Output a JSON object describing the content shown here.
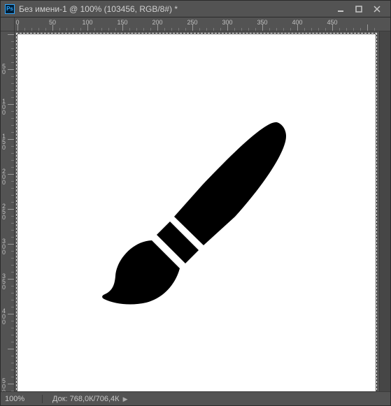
{
  "titlebar": {
    "app_icon": "Ps",
    "title": "Без имени-1 @ 100% (103456, RGB/8#) *"
  },
  "ruler": {
    "h_labels": [
      "0",
      "50",
      "100",
      "150",
      "200",
      "250",
      "300",
      "350",
      "400",
      "450"
    ],
    "v_labels": [
      "50",
      "100",
      "150",
      "200",
      "250",
      "300",
      "350",
      "400",
      "500"
    ]
  },
  "statusbar": {
    "zoom": "100%",
    "doc_label": "Док:",
    "doc_value": "768,0К/706,4К"
  },
  "canvas": {
    "content_description": "brush-shape",
    "fill": "#000000"
  }
}
